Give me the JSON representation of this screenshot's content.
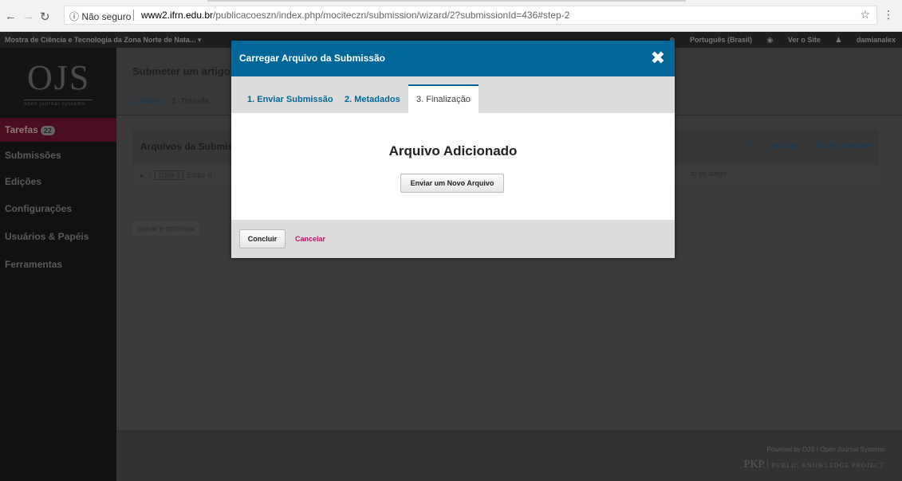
{
  "browser": {
    "security_label": "ⓘ Não seguro",
    "url_host": "www2.ifrn.edu.br",
    "url_path": "/publicacoeszn/index.php/mociteczn/submission/wizard/2?submissionId=436#step-2"
  },
  "topbar": {
    "context": "Mostra de Ciência e Tecnologia da Zona Norte de Nata... ▾",
    "language": "Português (Brasil)",
    "view_site": "Ver o Site",
    "user": "damianalex"
  },
  "logo": {
    "text": "OJS",
    "sub": "open journal systems"
  },
  "sidebar": {
    "items": [
      {
        "label": "Tarefas",
        "badge": "22"
      },
      {
        "label": "Submissões"
      },
      {
        "label": "Edições"
      },
      {
        "label": "Configurações"
      },
      {
        "label": "Usuários & Papéis"
      },
      {
        "label": "Ferramentas"
      }
    ]
  },
  "main": {
    "title": "Submeter um artigo",
    "step1": "1. Início",
    "step2": "2. Transfe",
    "panel_title": "Arquivos da Submiss",
    "search": "Buscar",
    "upload": "Enviar Arquivo",
    "file_id": "1099-1",
    "file_name": "Editor d",
    "file_type": "to do artigo",
    "save_continue": "Salvar e continuar",
    "footer_powered": "Powered by OJS | Open Journal Systems",
    "footer_pkp": "PKP",
    "footer_pkp_sub": "PUBLIC KNOWLEDGE PROJECT"
  },
  "modal": {
    "title": "Carregar Arquivo da Submissão",
    "tabs": [
      "1. Enviar Submissão",
      "2. Metadados",
      "3. Finalização"
    ],
    "heading": "Arquivo Adicionado",
    "new_file_button": "Enviar um Novo Arquivo",
    "ok_button": "Concluir",
    "cancel_link": "Cancelar"
  },
  "colors": {
    "accent": "#006798",
    "cancel": "#d00a6c"
  }
}
